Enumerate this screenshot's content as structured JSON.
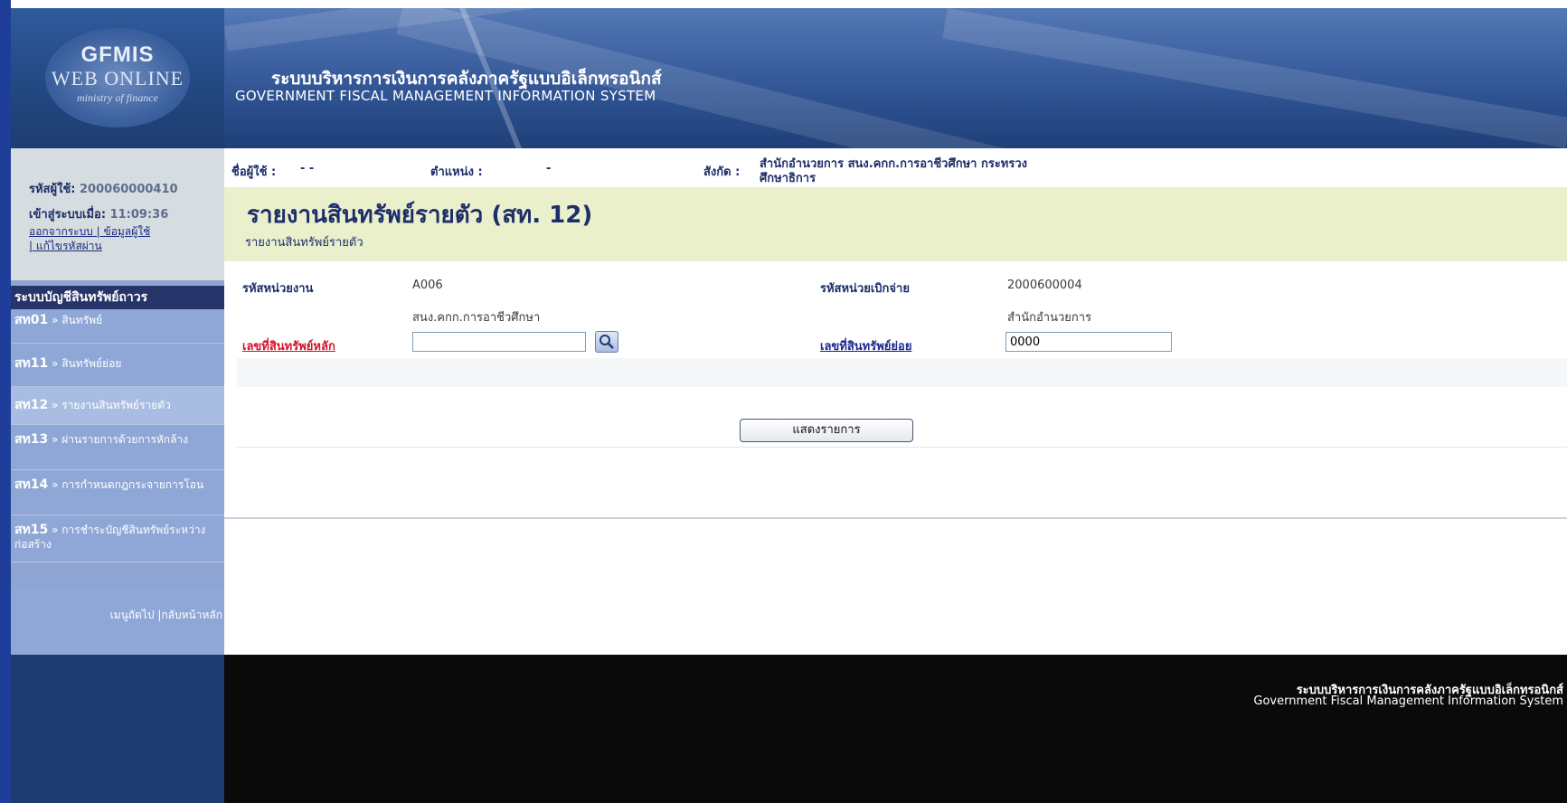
{
  "header": {
    "logo_top": "GFMIS",
    "logo_mid": "WEB ONLINE",
    "logo_bottom": "ministry of finance",
    "title_th": "ระบบบริหารการเงินการคลังภาครัฐแบบอิเล็กทรอนิกส์",
    "title_en": "GOVERNMENT FISCAL MANAGEMENT INFORMATION SYSTEM"
  },
  "user": {
    "id_label": "รหัสผู้ใช้:",
    "id_value": "200060000410",
    "login_label": "เข้าสู่ระบบเมื่อ:",
    "login_time": "11:09:36",
    "link_logout": "ออกจากระบบ",
    "link_userinfo": "ข้อมูลผู้ใช้",
    "link_change_password": "แก้ไขรหัสผ่าน"
  },
  "info_bar": {
    "username_label": "ชื่อผู้ใช้ :",
    "username_value": "- -",
    "position_label": "ตำแหน่ง :",
    "position_value": "-",
    "affiliation_label": "สังกัด :",
    "affiliation_value_1": "สำนักอำนวยการ สนง.คกก.การอาชีวศึกษา กระทรวง",
    "affiliation_value_2": "ศึกษาธิการ"
  },
  "sidebar": {
    "system_title": "ระบบบัญชีสินทรัพย์ถาวร",
    "items": [
      {
        "code": "สท01",
        "label": "» สินทรัพย์"
      },
      {
        "code": "สท11",
        "label": "» สินทรัพย์ย่อย"
      },
      {
        "code": "สท12",
        "label": "» รายงานสินทรัพย์รายตัว"
      },
      {
        "code": "สท13",
        "label": "» ผ่านรายการด้วยการหักล้าง"
      },
      {
        "code": "สท14",
        "label": "» การกำหนดกฎกระจายการโอน"
      },
      {
        "code": "สท15",
        "label": "» การชำระบัญชีสินทรัพย์ระหว่างก่อสร้าง"
      }
    ],
    "footer_next": "เมนูถัดไป",
    "footer_home": "กลับหน้าหลัก"
  },
  "page": {
    "title": "รายงานสินทรัพย์รายตัว (สท. 12)",
    "subtitle": "รายงานสินทรัพย์รายตัว"
  },
  "form": {
    "agency_code_label": "รหัสหน่วยงาน",
    "agency_code_value": "A006",
    "agency_name": "สนง.คกก.การอาชีวศึกษา",
    "disburse_code_label": "รหัสหน่วยเบิกจ่าย",
    "disburse_code_value": "2000600004",
    "disburse_name": "สำนักอำนวยการ",
    "main_asset_label": "เลขที่สินทรัพย์หลัก",
    "main_asset_value": "",
    "sub_asset_label": "เลขที่สินทรัพย์ย่อย",
    "sub_asset_value": "0000",
    "show_button": "แสดงรายการ"
  },
  "footer": {
    "th": "ระบบบริหารการเงินการคลังภาครัฐแบบอิเล็กทรอนิกส์",
    "en": "Government Fiscal Management Information System"
  }
}
